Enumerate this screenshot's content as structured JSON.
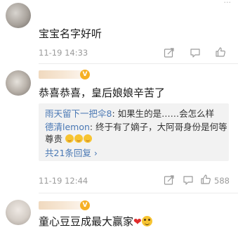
{
  "header_remnant": "...",
  "comments": [
    {
      "text": "宝宝名字好听",
      "time": "11-19 14:33",
      "like_count": "",
      "replies": []
    },
    {
      "badge": "V",
      "text": "恭喜恭喜，皇后娘娘辛苦了",
      "time": "11-19 12:44",
      "like_count": "588",
      "replies": [
        {
          "user": "雨天留下一把伞8",
          "sep": ": ",
          "text": "如果生的是……会怎么样"
        },
        {
          "user": "德清lemon",
          "sep": ": ",
          "text": "终于有了嫡子，大阿哥身份是何等",
          "text2": "尊贵"
        }
      ],
      "more_replies": "共21条回复",
      "more_arrow": "›"
    },
    {
      "badge": "V",
      "text": "童心豆豆成最大赢家",
      "heart": "❤"
    }
  ],
  "icons": [
    "share-icon",
    "comment-icon",
    "like-icon"
  ]
}
